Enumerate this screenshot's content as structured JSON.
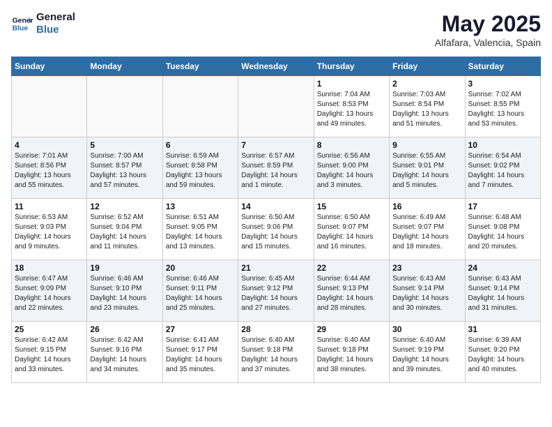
{
  "header": {
    "logo_line1": "General",
    "logo_line2": "Blue",
    "month_title": "May 2025",
    "location": "Alfafara, Valencia, Spain"
  },
  "days_of_week": [
    "Sunday",
    "Monday",
    "Tuesday",
    "Wednesday",
    "Thursday",
    "Friday",
    "Saturday"
  ],
  "weeks": [
    [
      {
        "num": "",
        "info": ""
      },
      {
        "num": "",
        "info": ""
      },
      {
        "num": "",
        "info": ""
      },
      {
        "num": "",
        "info": ""
      },
      {
        "num": "1",
        "info": "Sunrise: 7:04 AM\nSunset: 8:53 PM\nDaylight: 13 hours\nand 49 minutes."
      },
      {
        "num": "2",
        "info": "Sunrise: 7:03 AM\nSunset: 8:54 PM\nDaylight: 13 hours\nand 51 minutes."
      },
      {
        "num": "3",
        "info": "Sunrise: 7:02 AM\nSunset: 8:55 PM\nDaylight: 13 hours\nand 53 minutes."
      }
    ],
    [
      {
        "num": "4",
        "info": "Sunrise: 7:01 AM\nSunset: 8:56 PM\nDaylight: 13 hours\nand 55 minutes."
      },
      {
        "num": "5",
        "info": "Sunrise: 7:00 AM\nSunset: 8:57 PM\nDaylight: 13 hours\nand 57 minutes."
      },
      {
        "num": "6",
        "info": "Sunrise: 6:59 AM\nSunset: 8:58 PM\nDaylight: 13 hours\nand 59 minutes."
      },
      {
        "num": "7",
        "info": "Sunrise: 6:57 AM\nSunset: 8:59 PM\nDaylight: 14 hours\nand 1 minute."
      },
      {
        "num": "8",
        "info": "Sunrise: 6:56 AM\nSunset: 9:00 PM\nDaylight: 14 hours\nand 3 minutes."
      },
      {
        "num": "9",
        "info": "Sunrise: 6:55 AM\nSunset: 9:01 PM\nDaylight: 14 hours\nand 5 minutes."
      },
      {
        "num": "10",
        "info": "Sunrise: 6:54 AM\nSunset: 9:02 PM\nDaylight: 14 hours\nand 7 minutes."
      }
    ],
    [
      {
        "num": "11",
        "info": "Sunrise: 6:53 AM\nSunset: 9:03 PM\nDaylight: 14 hours\nand 9 minutes."
      },
      {
        "num": "12",
        "info": "Sunrise: 6:52 AM\nSunset: 9:04 PM\nDaylight: 14 hours\nand 11 minutes."
      },
      {
        "num": "13",
        "info": "Sunrise: 6:51 AM\nSunset: 9:05 PM\nDaylight: 14 hours\nand 13 minutes."
      },
      {
        "num": "14",
        "info": "Sunrise: 6:50 AM\nSunset: 9:06 PM\nDaylight: 14 hours\nand 15 minutes."
      },
      {
        "num": "15",
        "info": "Sunrise: 6:50 AM\nSunset: 9:07 PM\nDaylight: 14 hours\nand 16 minutes."
      },
      {
        "num": "16",
        "info": "Sunrise: 6:49 AM\nSunset: 9:07 PM\nDaylight: 14 hours\nand 18 minutes."
      },
      {
        "num": "17",
        "info": "Sunrise: 6:48 AM\nSunset: 9:08 PM\nDaylight: 14 hours\nand 20 minutes."
      }
    ],
    [
      {
        "num": "18",
        "info": "Sunrise: 6:47 AM\nSunset: 9:09 PM\nDaylight: 14 hours\nand 22 minutes."
      },
      {
        "num": "19",
        "info": "Sunrise: 6:46 AM\nSunset: 9:10 PM\nDaylight: 14 hours\nand 23 minutes."
      },
      {
        "num": "20",
        "info": "Sunrise: 6:46 AM\nSunset: 9:11 PM\nDaylight: 14 hours\nand 25 minutes."
      },
      {
        "num": "21",
        "info": "Sunrise: 6:45 AM\nSunset: 9:12 PM\nDaylight: 14 hours\nand 27 minutes."
      },
      {
        "num": "22",
        "info": "Sunrise: 6:44 AM\nSunset: 9:13 PM\nDaylight: 14 hours\nand 28 minutes."
      },
      {
        "num": "23",
        "info": "Sunrise: 6:43 AM\nSunset: 9:14 PM\nDaylight: 14 hours\nand 30 minutes."
      },
      {
        "num": "24",
        "info": "Sunrise: 6:43 AM\nSunset: 9:14 PM\nDaylight: 14 hours\nand 31 minutes."
      }
    ],
    [
      {
        "num": "25",
        "info": "Sunrise: 6:42 AM\nSunset: 9:15 PM\nDaylight: 14 hours\nand 33 minutes."
      },
      {
        "num": "26",
        "info": "Sunrise: 6:42 AM\nSunset: 9:16 PM\nDaylight: 14 hours\nand 34 minutes."
      },
      {
        "num": "27",
        "info": "Sunrise: 6:41 AM\nSunset: 9:17 PM\nDaylight: 14 hours\nand 35 minutes."
      },
      {
        "num": "28",
        "info": "Sunrise: 6:40 AM\nSunset: 9:18 PM\nDaylight: 14 hours\nand 37 minutes."
      },
      {
        "num": "29",
        "info": "Sunrise: 6:40 AM\nSunset: 9:18 PM\nDaylight: 14 hours\nand 38 minutes."
      },
      {
        "num": "30",
        "info": "Sunrise: 6:40 AM\nSunset: 9:19 PM\nDaylight: 14 hours\nand 39 minutes."
      },
      {
        "num": "31",
        "info": "Sunrise: 6:39 AM\nSunset: 9:20 PM\nDaylight: 14 hours\nand 40 minutes."
      }
    ]
  ]
}
